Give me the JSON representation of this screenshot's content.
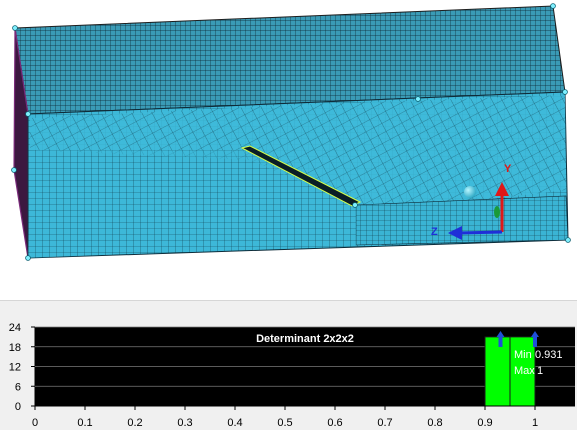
{
  "viewport": {
    "mesh_color": "#3db8d8",
    "mesh_line_color": "#0d2c3a",
    "triad_labels": {
      "y": "Y",
      "z": "Z"
    }
  },
  "chart_data": {
    "type": "bar",
    "title": "Determinant 2x2x2",
    "xlim": [
      0,
      1.08
    ],
    "ylim": [
      0,
      24
    ],
    "x_ticks": [
      "0",
      "0.1",
      "0.2",
      "0.3",
      "0.4",
      "0.5",
      "0.6",
      "0.7",
      "0.8",
      "0.9",
      "1"
    ],
    "y_ticks": [
      "0",
      "6",
      "12",
      "18",
      "24"
    ],
    "bins": [
      {
        "from": 0.9,
        "to": 0.95,
        "value": 21
      },
      {
        "from": 0.95,
        "to": 1.0,
        "value": 21
      }
    ],
    "min_label": "Min",
    "min_value": "0.931",
    "max_label": "Max",
    "max_value": "1",
    "marker_values": [
      0.931,
      1.0
    ],
    "grid": true,
    "colors": {
      "background": "#000000",
      "bar": "#00ff00",
      "marker": "#1f4fd8",
      "text": "#ffffff"
    }
  }
}
